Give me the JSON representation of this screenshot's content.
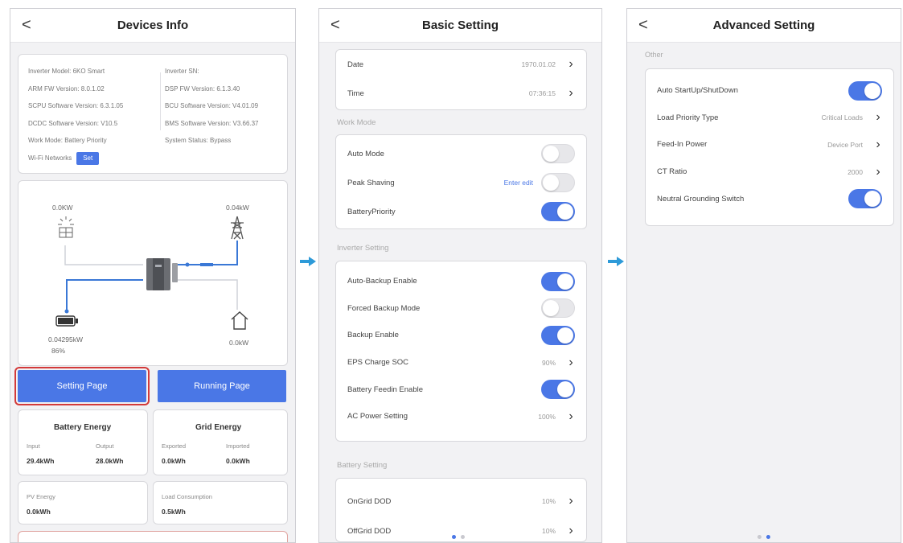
{
  "screen1": {
    "back": "<",
    "title": "Devices Info",
    "info": {
      "left": [
        "Inverter Model: 6KO Smart",
        "ARM FW Version: 8.0.1.02",
        "SCPU Software Version: 6.3.1.05",
        "DCDC Software Version: V10.5",
        "Work Mode: Battery Priority",
        "Wi-Fi Networks"
      ],
      "right": [
        "Inverter SN:",
        "DSP FW Version: 6.1.3.40",
        "BCU Software Version: V4.01.09",
        "BMS Software Version: V3.66.37",
        "System Status: Bypass"
      ],
      "set_label": "Set"
    },
    "diagram": {
      "pv_value": "0.0KW",
      "grid_value": "0.04kW",
      "battery_value": "0.04295kW",
      "battery_soc": "86%",
      "load_value": "0.0kW"
    },
    "setting_page": "Setting Page",
    "running_page": "Running Page",
    "battery_energy": {
      "title": "Battery Energy",
      "input_label": "Input",
      "output_label": "Output",
      "input_value": "29.4kWh",
      "output_value": "28.0kWh"
    },
    "grid_energy": {
      "title": "Grid Energy",
      "exported_label": "Exported",
      "imported_label": "Imported",
      "exported_value": "0.0kWh",
      "imported_value": "0.0kWh"
    },
    "pv_energy": {
      "label": "PV Energy",
      "value": "0.0kWh"
    },
    "load_consumption": {
      "label": "Load Consumption",
      "value": "0.5kWh"
    }
  },
  "screen2": {
    "back": "<",
    "title": "Basic Setting",
    "date": {
      "label": "Date",
      "value": "1970.01.02"
    },
    "time": {
      "label": "Time",
      "value": "07:36:15"
    },
    "work_mode_section": "Work Mode",
    "auto_mode": {
      "label": "Auto Mode",
      "on": false
    },
    "peak_shaving": {
      "label": "Peak Shaving",
      "edit": "Enter edit",
      "on": false
    },
    "battery_priority": {
      "label": "BatteryPriority",
      "on": true
    },
    "inverter_section": "Inverter Setting",
    "auto_backup": {
      "label": "Auto-Backup Enable",
      "on": true
    },
    "forced_backup": {
      "label": "Forced Backup Mode",
      "on": false
    },
    "backup_enable": {
      "label": "Backup Enable",
      "on": true
    },
    "eps_charge": {
      "label": "EPS Charge SOC",
      "value": "90%"
    },
    "battery_feedin": {
      "label": "Battery Feedin Enable",
      "on": true
    },
    "ac_power": {
      "label": "AC Power Setting",
      "value": "100%"
    },
    "battery_section": "Battery Setting",
    "ongrid_dod": {
      "label": "OnGrid DOD",
      "value": "10%"
    },
    "offgrid_dod": {
      "label": "OffGrid DOD",
      "value": "10%"
    }
  },
  "screen3": {
    "back": "<",
    "title": "Advanced Setting",
    "other_section": "Other",
    "auto_startup": {
      "label": "Auto StartUp/ShutDown",
      "on": true
    },
    "load_priority": {
      "label": "Load Priority Type",
      "value": "Critical Loads"
    },
    "feed_in": {
      "label": "Feed-In Power",
      "value": "Device Port"
    },
    "ct_ratio": {
      "label": "CT Ratio",
      "value": "2000"
    },
    "neutral_grounding": {
      "label": "Neutral Grounding Switch",
      "on": true
    }
  },
  "colors": {
    "accent": "#4a77e6",
    "highlight_border": "#d33a3a",
    "arrow": "#2d9ad8"
  }
}
